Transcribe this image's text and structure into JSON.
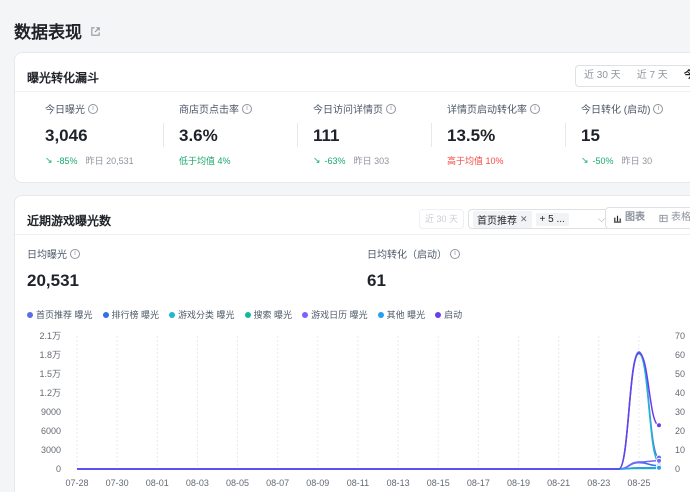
{
  "page": {
    "title": "数据表现"
  },
  "funnel": {
    "title": "曝光转化漏斗",
    "ranges": [
      "近 30 天",
      "近 7 天",
      "今日"
    ],
    "active_range": 2,
    "metrics": [
      {
        "label": "今日曝光",
        "value": "3,046",
        "delta": "-85%",
        "compare": "昨日 20,531",
        "note": "",
        "note_type": ""
      },
      {
        "label": "商店页点击率",
        "value": "3.6%",
        "delta": "",
        "compare": "",
        "note": "低于均值 4%",
        "note_type": "good"
      },
      {
        "label": "今日访问详情页",
        "value": "111",
        "delta": "-63%",
        "compare": "昨日 303",
        "note": "",
        "note_type": ""
      },
      {
        "label": "详情页启动转化率",
        "value": "13.5%",
        "delta": "",
        "compare": "",
        "note": "高于均值 10%",
        "note_type": "bad"
      },
      {
        "label": "今日转化 (启动)",
        "value": "15",
        "delta": "-50%",
        "compare": "昨日 30",
        "note": "",
        "note_type": ""
      }
    ]
  },
  "exposure": {
    "title": "近期游戏曝光数",
    "range_label": "近 30 天",
    "filter_tag": "首页推荐",
    "filter_more": "+ 5 ...",
    "views": [
      "图表",
      "表格"
    ],
    "active_view": 0,
    "avg_exposure_label": "日均曝光",
    "avg_exposure_value": "20,531",
    "avg_conv_label": "日均转化（启动）",
    "avg_conv_value": "61"
  },
  "icons": {
    "external": "external-link-icon",
    "info": "info-icon",
    "down": "arrow-down-icon",
    "chart": "bar-chart-icon",
    "table": "table-icon",
    "close": "close-icon",
    "chevron": "chevron-down-icon"
  },
  "chart_data": {
    "type": "line",
    "title": "",
    "x_ticks": [
      "07-28",
      "07-30",
      "08-01",
      "08-03",
      "08-05",
      "08-07",
      "08-09",
      "08-11",
      "08-13",
      "08-15",
      "08-17",
      "08-19",
      "08-21",
      "08-23",
      "08-25"
    ],
    "x": [
      "07-28",
      "07-29",
      "07-30",
      "07-31",
      "08-01",
      "08-02",
      "08-03",
      "08-04",
      "08-05",
      "08-06",
      "08-07",
      "08-08",
      "08-09",
      "08-10",
      "08-11",
      "08-12",
      "08-13",
      "08-14",
      "08-15",
      "08-16",
      "08-17",
      "08-18",
      "08-19",
      "08-20",
      "08-21",
      "08-22",
      "08-23",
      "08-24",
      "08-25",
      "08-26"
    ],
    "y_left_ticks": [
      "0",
      "3000",
      "6000",
      "9000",
      "1.2万",
      "1.5万",
      "1.8万",
      "2.1万"
    ],
    "y_left_lim": [
      0,
      21000
    ],
    "y_right_ticks": [
      "0",
      "10",
      "20",
      "30",
      "40",
      "50",
      "60",
      "70"
    ],
    "y_right_lim": [
      0,
      70
    ],
    "legend_position": "top-left",
    "series": [
      {
        "name": "首页推荐 曝光",
        "color": "#5b6ee8",
        "axis": "left",
        "values": [
          0,
          0,
          0,
          0,
          0,
          0,
          0,
          0,
          0,
          0,
          0,
          0,
          0,
          0,
          0,
          0,
          0,
          0,
          0,
          0,
          0,
          0,
          0,
          0,
          0,
          0,
          0,
          0,
          18500,
          1800
        ]
      },
      {
        "name": "排行榜 曝光",
        "color": "#3470e8",
        "axis": "left",
        "values": [
          0,
          0,
          0,
          0,
          0,
          0,
          0,
          0,
          0,
          0,
          0,
          0,
          0,
          0,
          0,
          0,
          0,
          0,
          0,
          0,
          0,
          0,
          0,
          0,
          0,
          0,
          0,
          0,
          1000,
          500
        ]
      },
      {
        "name": "游戏分类 曝光",
        "color": "#1fb6d2",
        "axis": "left",
        "values": [
          0,
          0,
          0,
          0,
          0,
          0,
          0,
          0,
          0,
          0,
          0,
          0,
          0,
          0,
          0,
          0,
          0,
          0,
          0,
          0,
          0,
          0,
          0,
          0,
          0,
          0,
          0,
          0,
          18200,
          1100
        ]
      },
      {
        "name": "搜索 曝光",
        "color": "#14b89a",
        "axis": "left",
        "values": [
          0,
          0,
          0,
          0,
          0,
          0,
          0,
          0,
          0,
          0,
          0,
          0,
          0,
          0,
          0,
          0,
          0,
          0,
          0,
          0,
          0,
          0,
          0,
          0,
          0,
          0,
          0,
          0,
          100,
          100
        ]
      },
      {
        "name": "游戏日历 曝光",
        "color": "#7b61ff",
        "axis": "left",
        "values": [
          0,
          0,
          0,
          0,
          0,
          0,
          0,
          0,
          0,
          0,
          0,
          0,
          0,
          0,
          0,
          0,
          0,
          0,
          0,
          0,
          0,
          0,
          0,
          0,
          0,
          0,
          0,
          0,
          1100,
          1300
        ]
      },
      {
        "name": "其他 曝光",
        "color": "#23a0f0",
        "axis": "left",
        "values": [
          0,
          0,
          0,
          0,
          0,
          0,
          0,
          0,
          0,
          0,
          0,
          0,
          0,
          0,
          0,
          0,
          0,
          0,
          0,
          0,
          0,
          0,
          0,
          0,
          0,
          0,
          0,
          0,
          200,
          200
        ]
      },
      {
        "name": "启动",
        "color": "#6a3df0",
        "axis": "right",
        "values": [
          0,
          0,
          0,
          0,
          0,
          0,
          0,
          0,
          0,
          0,
          0,
          0,
          0,
          0,
          0,
          0,
          0,
          0,
          0,
          0,
          0,
          0,
          0,
          0,
          0,
          0,
          0,
          0,
          61,
          23
        ]
      }
    ]
  }
}
